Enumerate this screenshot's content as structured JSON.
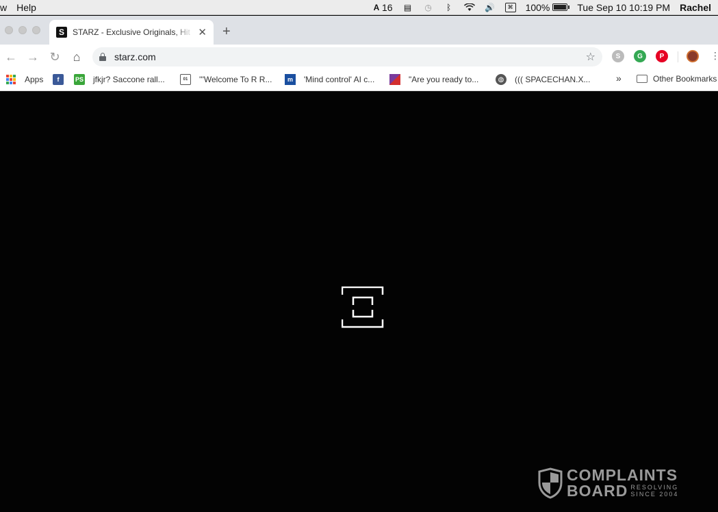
{
  "menubar": {
    "left_items": [
      "w",
      "Help"
    ],
    "adobe_badge": "16",
    "battery_percent": "100%",
    "datetime": "Tue Sep 10  10:19 PM",
    "user": "Rachel"
  },
  "tab": {
    "title": "STARZ - Exclusive Originals, Hit Movies",
    "favicon_letter": "S",
    "close_glyph": "✕",
    "new_tab_glyph": "+"
  },
  "toolbar": {
    "url": "starz.com",
    "star_glyph": "☆",
    "menu_glyph": "⋮"
  },
  "bookmarks": {
    "items": [
      {
        "label": "Apps"
      },
      {
        "label": ""
      },
      {
        "label": "jfkjr? Saccone rall..."
      },
      {
        "label": "'''Welcome To R R..."
      },
      {
        "label": "'Mind control' AI c..."
      },
      {
        "label": "\"Are you ready to..."
      },
      {
        "label": "((( SPACECHAN.X..."
      }
    ],
    "overflow": "»",
    "other_bookmarks": "Other Bookmarks"
  },
  "watermark": {
    "line1": "COMPLAINTS",
    "line2": "BOARD",
    "tag1": "RESOLVING",
    "tag2": "SINCE 2004"
  },
  "colors": {
    "background": "#030303",
    "tab_strip": "#dee1e6",
    "omnibox": "#f1f3f4",
    "watermark": "#9a9a9a"
  }
}
